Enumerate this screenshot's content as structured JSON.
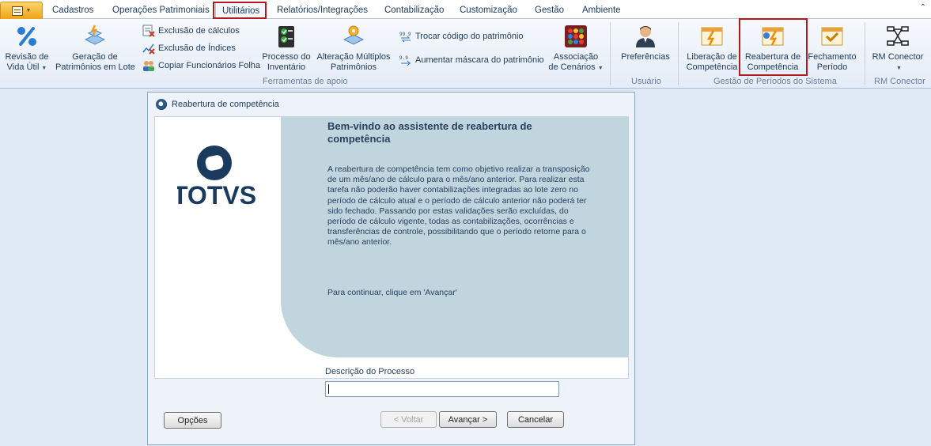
{
  "tabs": [
    {
      "label": "Cadastros"
    },
    {
      "label": "Operações Patrimoniais"
    },
    {
      "label": "Utilitários",
      "active": true
    },
    {
      "label": "Relatórios/Integrações"
    },
    {
      "label": "Contabilização"
    },
    {
      "label": "Customização"
    },
    {
      "label": "Gestão"
    },
    {
      "label": "Ambiente"
    }
  ],
  "ribbon": {
    "tools": {
      "revisao": {
        "line1": "Revisão de",
        "line2": "Vida Útil",
        "icon": "percent-icon"
      },
      "geracao": {
        "line1": "Geração de",
        "line2": "Patrimônios em Lote",
        "icon": "asset-batch-icon"
      },
      "small": [
        {
          "label": "Exclusão de cálculos",
          "icon": "delete-calc-icon"
        },
        {
          "label": "Exclusão de Índices",
          "icon": "delete-index-icon"
        },
        {
          "label": "Copiar Funcionários Folha",
          "icon": "copy-employees-icon"
        }
      ],
      "processo": {
        "line1": "Processo do",
        "line2": "Inventário",
        "icon": "inventory-check-icon"
      },
      "alteracao": {
        "line1": "Alteração Múltiplos",
        "line2": "Patrimônios",
        "icon": "multi-asset-icon"
      },
      "small2": [
        {
          "label": "Trocar código do patrimônio",
          "icon": "swap-code-icon"
        },
        {
          "label": "Aumentar máscara do patrimônio",
          "icon": "mask-icon"
        }
      ],
      "associacao": {
        "line1": "Associação",
        "line2": "de Cenários",
        "icon": "scenario-icon"
      },
      "group_label": "Ferramentas de apoio"
    },
    "usuario": {
      "preferencias": {
        "label": "Preferências",
        "icon": "user-icon"
      },
      "group_label": "Usuário"
    },
    "gestao": {
      "liberacao": {
        "line1": "Liberação de",
        "line2": "Competência",
        "icon": "release-period-icon"
      },
      "reabertura": {
        "line1": "Reabertura de",
        "line2": "Competência",
        "icon": "reopen-period-icon"
      },
      "fechamento": {
        "line1": "Fechamento",
        "line2": "Período",
        "icon": "close-period-icon"
      },
      "group_label": "Gestão de Períodos do Sistema"
    },
    "rm": {
      "conector": {
        "label": "RM Conector",
        "icon": "rm-connector-icon"
      },
      "group_label": "RM Conector"
    }
  },
  "dialog": {
    "title": "Reabertura de competência",
    "logo_text": "TOTVS",
    "welcome_title": "Bem-vindo ao assistente de reabertura de competência",
    "description": "A reabertura de competência tem como objetivo realizar a transposição de um mês/ano de cálculo para o mês/ano anterior. Para realizar esta tarefa não poderão haver contabilizações integradas ao lote zero no período de cálculo atual e o período de cálculo anterior não poderá ter sido fechado. Passando por estas validações serão excluídas, do período de cálculo vigente, todas as contabilizações, ocorrências e transferências de controle, possibilitando que o período retorne para o mês/ano anterior.",
    "continue_text": "Para continuar, clique em 'Avançar'",
    "field_label": "Descrição do Processo",
    "field_value": "",
    "buttons": {
      "opcoes": "Opções",
      "voltar": "< Voltar",
      "avancar": "Avançar >",
      "cancelar": "Cancelar"
    }
  },
  "colors": {
    "highlight": "#b01c1c",
    "panel_blue": "#c0d5de",
    "totvs_blue": "#1a3a5e"
  }
}
